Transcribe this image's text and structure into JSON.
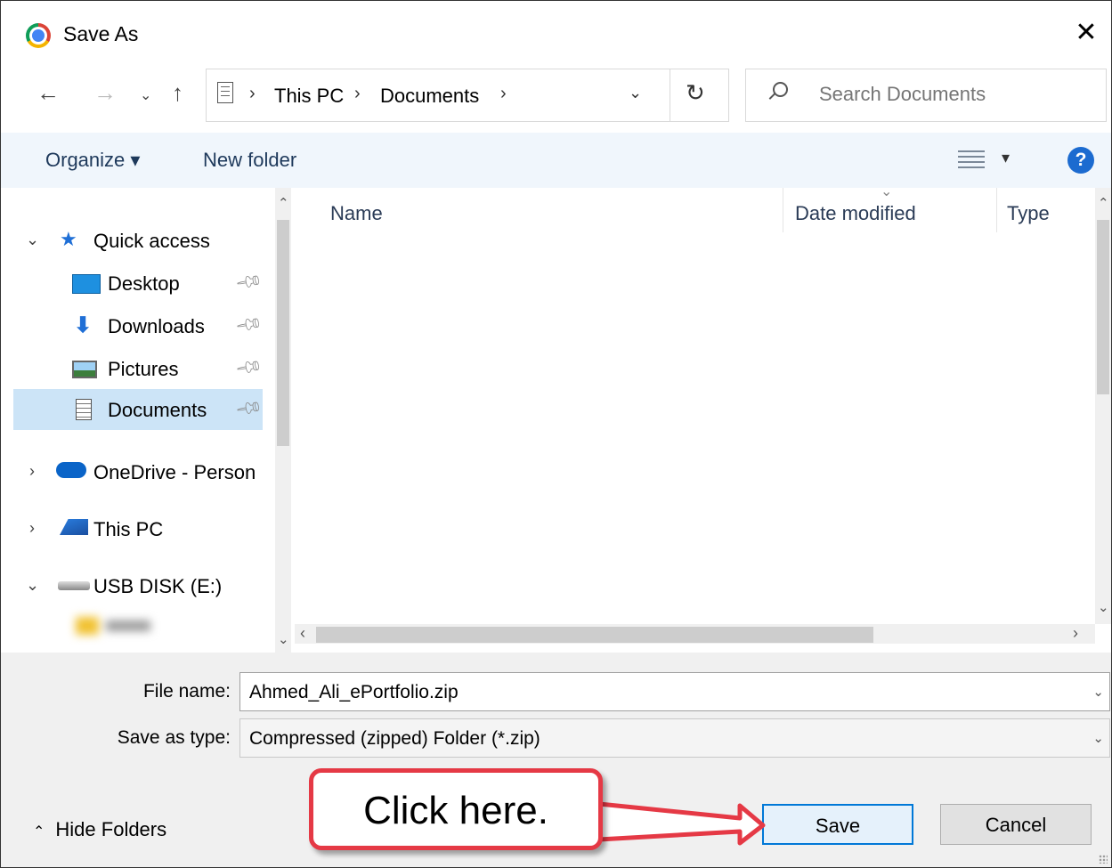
{
  "title": "Save As",
  "address": {
    "crumbs": [
      "This PC",
      "Documents"
    ]
  },
  "search": {
    "placeholder": "Search Documents"
  },
  "toolbar": {
    "organize": "Organize ▾",
    "new_folder": "New folder",
    "help": "?"
  },
  "tree": {
    "quick_access": "Quick access",
    "items": [
      "Desktop",
      "Downloads",
      "Pictures",
      "Documents"
    ],
    "onedrive": "OneDrive - Person",
    "this_pc": "This PC",
    "usb": "USB DISK (E:)"
  },
  "columns": [
    "Name",
    "Date modified",
    "Type"
  ],
  "file_name": {
    "label": "File name:",
    "value": "Ahmed_Ali_ePortfolio.zip"
  },
  "save_type": {
    "label": "Save as type:",
    "value": "Compressed (zipped) Folder (*.zip)"
  },
  "hide_folders": "Hide Folders",
  "buttons": {
    "save": "Save",
    "cancel": "Cancel"
  },
  "callout": "Click here.",
  "colors": {
    "callout_border": "#e53945",
    "selection": "#cce4f7",
    "primary_border": "#0078d7",
    "help_blue": "#1c6bd0"
  }
}
